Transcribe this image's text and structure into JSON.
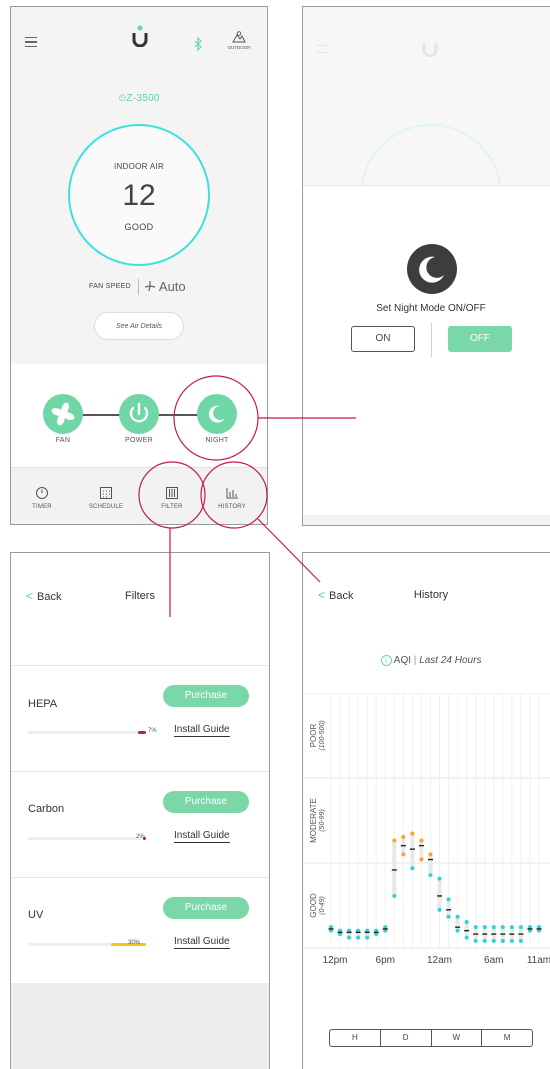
{
  "main": {
    "model": "⏲Z-3500",
    "outdoor_label": "OUTDOOR",
    "indoor_air_label": "INDOOR AIR",
    "aqi_value": "12",
    "aqi_status": "GOOD",
    "fan_speed_label": "FAN SPEED",
    "fan_speed_value": "Auto",
    "details_button": "See Air Details",
    "controls": [
      {
        "label": "FAN"
      },
      {
        "label": "POWER"
      },
      {
        "label": "NIGHT"
      }
    ],
    "tabs": [
      {
        "label": "TIMER"
      },
      {
        "label": "SCHEDULE"
      },
      {
        "label": "FILTER"
      },
      {
        "label": "HISTORY"
      }
    ]
  },
  "night_mode": {
    "title": "Set Night Mode ON/OFF",
    "on_label": "ON",
    "off_label": "OFF",
    "selected": "OFF"
  },
  "filters": {
    "back_label": "Back",
    "title": "Filters",
    "items": [
      {
        "name": "HEPA",
        "purchase_label": "Purchase",
        "install_label": "Install Guide",
        "percent_label": "7%",
        "percent": 7,
        "color": "#c2185b"
      },
      {
        "name": "Carbon",
        "purchase_label": "Purchase",
        "install_label": "Install Guide",
        "percent_label": "2%",
        "percent": 2,
        "color": "#c2185b"
      },
      {
        "name": "UV",
        "purchase_label": "Purchase",
        "install_label": "Install Guide",
        "percent_label": "30%",
        "percent": 30,
        "color": "#f5c518"
      }
    ]
  },
  "history": {
    "back_label": "Back",
    "title": "History",
    "aqi_label": "AQI",
    "period_label": "Last 24 Hours",
    "range_buttons": [
      "H",
      "D",
      "W",
      "M"
    ],
    "selected_range": "H"
  },
  "chart_data": {
    "type": "scatter",
    "title": "",
    "bands": [
      {
        "label": "GOOD",
        "range_label": "(0-49)",
        "range": [
          0,
          49
        ]
      },
      {
        "label": "MODERATE",
        "range_label": "(50-99)",
        "range": [
          50,
          99
        ]
      },
      {
        "label": "POOR",
        "range_label": "(100-500)",
        "range": [
          100,
          500
        ]
      }
    ],
    "x_tick_labels": [
      "12pm",
      "6pm",
      "12am",
      "6am",
      "11am"
    ],
    "x": [
      "12pm",
      "1pm",
      "2pm",
      "3pm",
      "4pm",
      "5pm",
      "6pm",
      "7pm",
      "8pm",
      "9pm",
      "10pm",
      "11pm",
      "12am",
      "1am",
      "2am",
      "3am",
      "4am",
      "5am",
      "6am",
      "7am",
      "8am",
      "9am",
      "10am",
      "11am"
    ],
    "series": [
      {
        "values_max": [
          12,
          10,
          10,
          10,
          10,
          10,
          12,
          63,
          65,
          67,
          63,
          55,
          40,
          28,
          18,
          15,
          12,
          12,
          12,
          12,
          12,
          12,
          12,
          12
        ]
      },
      {
        "values_avg": [
          11,
          9,
          9,
          9,
          9,
          9,
          11,
          45,
          60,
          58,
          60,
          52,
          30,
          22,
          12,
          10,
          8,
          8,
          8,
          8,
          8,
          8,
          11,
          11
        ]
      },
      {
        "values_min": [
          10,
          8,
          6,
          6,
          6,
          8,
          10,
          30,
          55,
          46,
          52,
          42,
          22,
          18,
          10,
          6,
          4,
          4,
          4,
          4,
          4,
          4,
          10,
          10
        ]
      }
    ],
    "colors": {
      "moderate": "#f5a623",
      "good": "#29d6d6",
      "avg": "#222222"
    }
  },
  "colors": {
    "accent_green": "#6fd6a6",
    "accent_cyan": "#3fe0dc",
    "annotation_magenta": "#c2185b"
  }
}
